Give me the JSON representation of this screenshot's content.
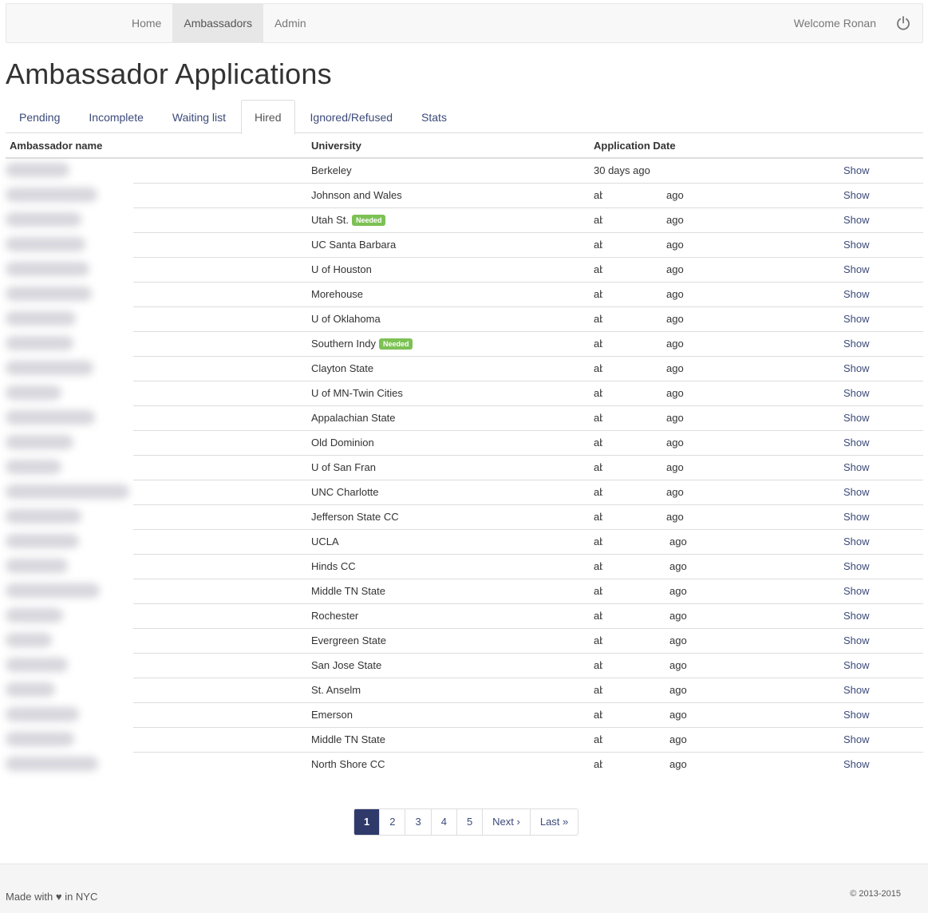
{
  "nav": {
    "items": [
      "Home",
      "Ambassadors",
      "Admin"
    ],
    "active": 1,
    "welcome": "Welcome Ronan"
  },
  "page_title": "Ambassador Applications",
  "tabs": {
    "items": [
      "Pending",
      "Incomplete",
      "Waiting list",
      "Hired",
      "Ignored/Refused",
      "Stats"
    ],
    "active": 3
  },
  "table": {
    "headers": [
      "Ambassador name",
      "University",
      "Application Date"
    ],
    "show_label": "Show",
    "badge_label": "Needed",
    "rows": [
      {
        "university": "Berkeley",
        "date_a": "30 days ago",
        "date_b": "",
        "needed": false
      },
      {
        "university": "Johnson and Wales",
        "date_a": "ab",
        "date_b": "ago",
        "needed": false
      },
      {
        "university": "Utah St.",
        "date_a": "ab",
        "date_b": "ago",
        "needed": true
      },
      {
        "university": "UC Santa Barbara",
        "date_a": "ab",
        "date_b": "ago",
        "needed": false
      },
      {
        "university": "U of Houston",
        "date_a": "ab",
        "date_b": "ago",
        "needed": false
      },
      {
        "university": "Morehouse",
        "date_a": "ab",
        "date_b": "ago",
        "needed": false
      },
      {
        "university": "U of Oklahoma",
        "date_a": "ab",
        "date_b": "ago",
        "needed": false
      },
      {
        "university": "Southern Indy",
        "date_a": "ab",
        "date_b": "ago",
        "needed": true
      },
      {
        "university": "Clayton State",
        "date_a": "ab",
        "date_b": "ago",
        "needed": false
      },
      {
        "university": "U of MN-Twin Cities",
        "date_a": "ab",
        "date_b": "ago",
        "needed": false
      },
      {
        "university": "Appalachian State",
        "date_a": "ab",
        "date_b": "ago",
        "needed": false
      },
      {
        "university": "Old Dominion",
        "date_a": "ab",
        "date_b": "ago",
        "needed": false
      },
      {
        "university": "U of San Fran",
        "date_a": "ab",
        "date_b": "ago",
        "needed": false
      },
      {
        "university": "UNC Charlotte",
        "date_a": "ab",
        "date_b": "ago",
        "needed": false
      },
      {
        "university": "Jefferson State CC",
        "date_a": "ab",
        "date_b": "ago",
        "needed": false
      },
      {
        "university": "UCLA",
        "date_a": "ab",
        "date_b": "ago",
        "needed": false
      },
      {
        "university": "Hinds CC",
        "date_a": "ab",
        "date_b": "ago",
        "needed": false
      },
      {
        "university": "Middle TN State",
        "date_a": "ab",
        "date_b": "ago",
        "needed": false
      },
      {
        "university": "Rochester",
        "date_a": "ab",
        "date_b": "ago",
        "needed": false
      },
      {
        "university": "Evergreen State",
        "date_a": "ab",
        "date_b": "ago",
        "needed": false
      },
      {
        "university": "San Jose State",
        "date_a": "ab",
        "date_b": "ago",
        "needed": false
      },
      {
        "university": "St. Anselm",
        "date_a": "ab",
        "date_b": "ago",
        "needed": false
      },
      {
        "university": "Emerson",
        "date_a": "ab",
        "date_b": "ago",
        "needed": false
      },
      {
        "university": "Middle TN State",
        "date_a": "ab",
        "date_b": "ago",
        "needed": false
      },
      {
        "university": "North Shore CC",
        "date_a": "ab",
        "date_b": "ago",
        "needed": false
      }
    ]
  },
  "pagination": {
    "items": [
      "1",
      "2",
      "3",
      "4",
      "5",
      "Next ›",
      "Last »"
    ],
    "active": 0
  },
  "footer": {
    "left": "Made with ♥ in NYC",
    "right": "© 2013-2015"
  },
  "colors": {
    "link": "#3b4a7a",
    "badge": "#7cc154",
    "pagination_active": "#2f3a6b"
  }
}
